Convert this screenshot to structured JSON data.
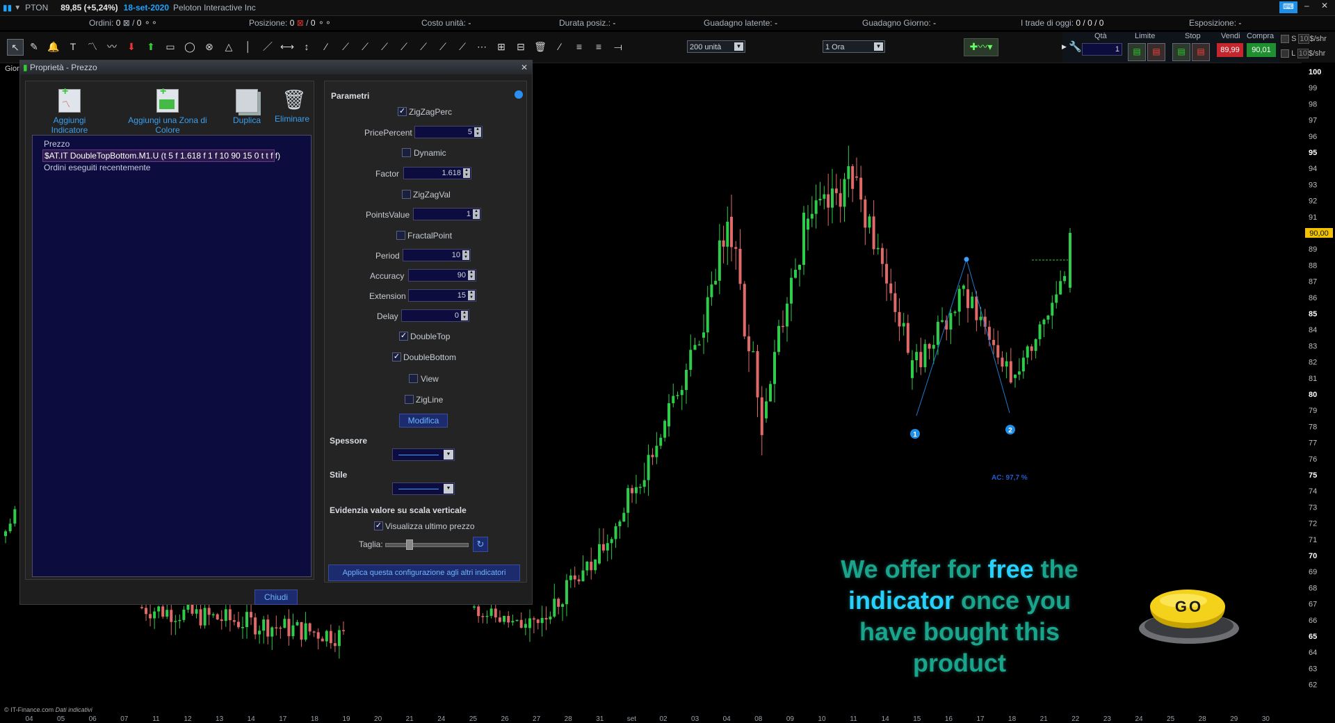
{
  "topbar": {
    "ticker": "PTON",
    "price": "89,85 (+5,24%)",
    "date": "18-set-2020",
    "name": "Peloton Interactive Inc"
  },
  "infobar": {
    "ordini_label": "Ordini:",
    "ordini_value": "0",
    "ordini_value2": "0",
    "posizione_label": "Posizione:",
    "posizione_value": "0",
    "posizione_value2": "0",
    "costo_label": "Costo unità:",
    "costo_value": "-",
    "durata_label": "Durata posiz.:",
    "durata_value": "-",
    "guadagno_latente_label": "Guadagno latente:",
    "guadagno_latente_value": "-",
    "guadagno_giorno_label": "Guadagno Giorno:",
    "guadagno_giorno_value": "-",
    "trade_label": "I trade di oggi:",
    "trade_value": "0 / 0 / 0",
    "esposizione_label": "Esposizione:",
    "esposizione_value": "-"
  },
  "toolbar": {
    "quantity_select": "200 unità",
    "timeframe_select": "1 Ora"
  },
  "orderbox": {
    "qta_label": "Qtà",
    "qta_value": "1",
    "limite_label": "Limite",
    "stop_label": "Stop",
    "vendi_label": "Vendi",
    "compra_label": "Compra",
    "vendi_price": "89,99",
    "compra_price": "90,01",
    "s_label": "S",
    "l_label": "L",
    "s_value": "10",
    "l_value": "10",
    "unit": "$/shr"
  },
  "dialog": {
    "title": "Proprietà - Prezzo",
    "left_tab_fragment": "Gior",
    "buttons": {
      "add_indicator": "Aggiungi Indicatore",
      "add_zone": "Aggiungi una Zona di Colore",
      "duplicate": "Duplica",
      "delete": "Eliminare"
    },
    "tree": [
      "Prezzo",
      "$AT.IT DoubleTopBottom.M1.U (t 5 f 1.618 f 1 f 10 90 15 0 t t f f)",
      "Ordini eseguiti recentemente"
    ],
    "close_button": "Chiudi",
    "params": {
      "header": "Parametri",
      "zigzagperc": "ZigZagPerc",
      "pricepercent_label": "PricePercent",
      "pricepercent": "5",
      "dynamic": "Dynamic",
      "factor_label": "Factor",
      "factor": "1.618",
      "zigzagval": "ZigZagVal",
      "pointsvalue_label": "PointsValue",
      "pointsvalue": "1",
      "fractalpoint": "FractalPoint",
      "period_label": "Period",
      "period": "10",
      "accuracy_label": "Accuracy",
      "accuracy": "90",
      "extension_label": "Extension",
      "extension": "15",
      "delay_label": "Delay",
      "delay": "0",
      "doubletop": "DoubleTop",
      "doublebottom": "DoubleBottom",
      "view": "View",
      "zigline": "ZigLine",
      "modify_button": "Modifica",
      "spessore": "Spessore",
      "stile": "Stile",
      "evidenzia": "Evidenzia valore su scala verticale",
      "visualizza": "Visualizza ultimo prezzo",
      "taglia": "Taglia:",
      "apply_button": "Applica questa configurazione agli altri indicatori"
    }
  },
  "chart_data": {
    "type": "candlestick",
    "ylim": [
      61,
      100.5
    ],
    "yticks": [
      "100",
      "99",
      "98",
      "97",
      "96",
      "95",
      "94",
      "93",
      "92",
      "91",
      "90",
      "89",
      "88",
      "87",
      "86",
      "85",
      "84",
      "83",
      "82",
      "81",
      "80",
      "79",
      "78",
      "77",
      "76",
      "75",
      "74",
      "73",
      "72",
      "71",
      "70",
      "69",
      "68",
      "67",
      "66",
      "65",
      "64",
      "63",
      "62"
    ],
    "yticks_bold": [
      "100",
      "95",
      "90",
      "85",
      "80",
      "75",
      "70",
      "65"
    ],
    "xticks": [
      "04",
      "05",
      "06",
      "07",
      "11",
      "12",
      "13",
      "14",
      "17",
      "18",
      "19",
      "20",
      "21",
      "24",
      "25",
      "26",
      "27",
      "28",
      "31",
      "set",
      "02",
      "03",
      "04",
      "08",
      "09",
      "10",
      "11",
      "14",
      "15",
      "16",
      "17",
      "18",
      "21",
      "22",
      "23",
      "24",
      "25",
      "28",
      "29",
      "30"
    ],
    "last_price": "90,00",
    "pattern_labels": [
      "1",
      "2"
    ],
    "annotation": "AC: 97,7 %",
    "key_prices": {
      "peak": 98.5,
      "double_bottom_1": 79,
      "double_bottom_2": 79.3,
      "neckline": 88.4,
      "last": 90
    }
  },
  "promo": {
    "line1a": "We offer for ",
    "line1b": "free",
    "line1c": " the",
    "line2a": "indicator",
    "line2b": " once you",
    "line3": "have bought this",
    "line4": "product"
  },
  "go_button": "GO",
  "footer": {
    "source": "© IT-Finance.com",
    "note": "Dati indicativi"
  },
  "colors": {
    "up": "#2ecc4a",
    "down": "#e06a6a",
    "accent": "#1fa3ff"
  }
}
